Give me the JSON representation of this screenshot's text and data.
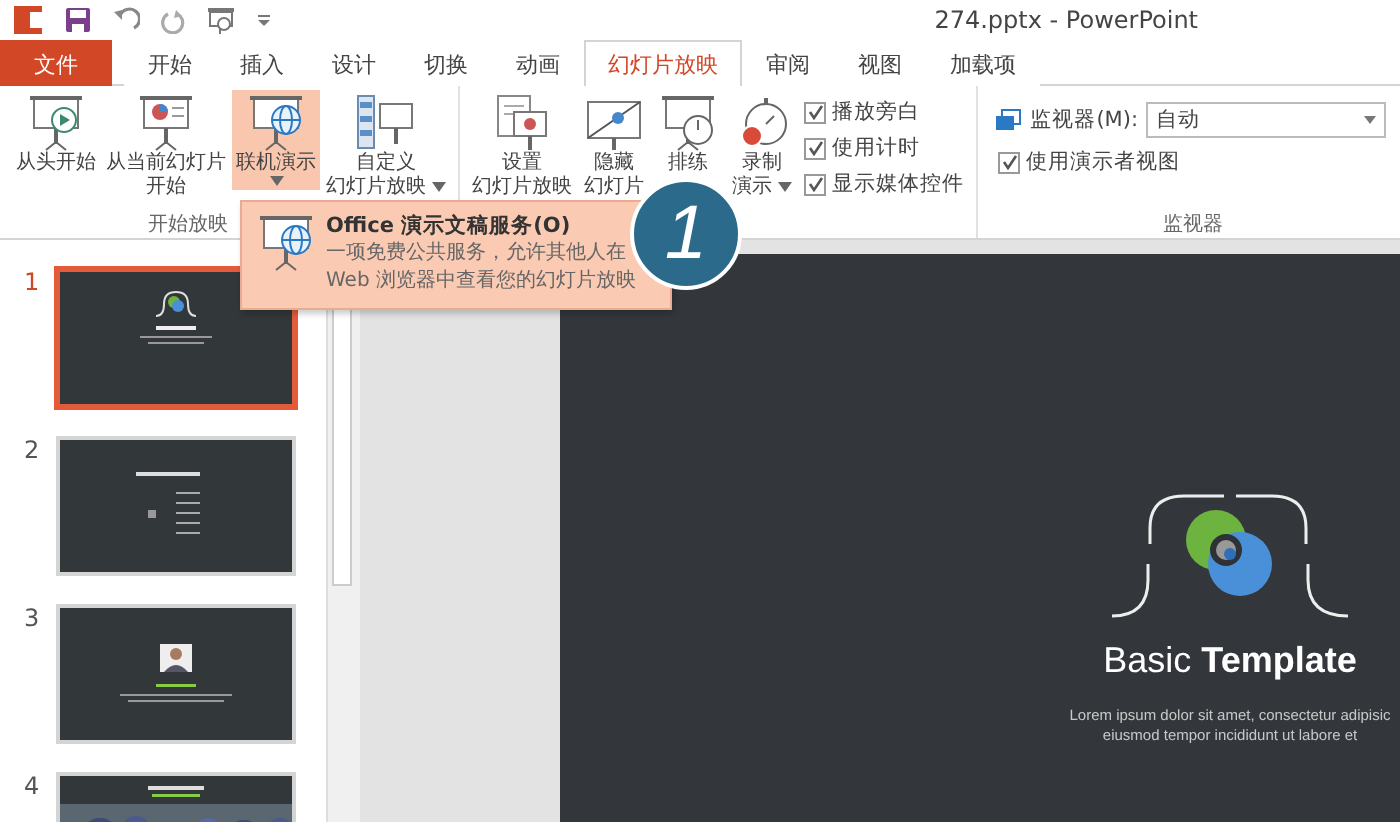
{
  "window": {
    "title": "274.pptx - PowerPoint"
  },
  "tabs": [
    {
      "label": "文件",
      "kind": "file",
      "selected": false
    },
    {
      "label": "开始",
      "kind": "tab",
      "selected": false
    },
    {
      "label": "插入",
      "kind": "tab",
      "selected": false
    },
    {
      "label": "设计",
      "kind": "tab",
      "selected": false
    },
    {
      "label": "切换",
      "kind": "tab",
      "selected": false
    },
    {
      "label": "动画",
      "kind": "tab",
      "selected": false
    },
    {
      "label": "幻灯片放映",
      "kind": "tab",
      "selected": true
    },
    {
      "label": "审阅",
      "kind": "tab",
      "selected": false
    },
    {
      "label": "视图",
      "kind": "tab",
      "selected": false
    },
    {
      "label": "加载项",
      "kind": "tab",
      "selected": false
    }
  ],
  "ribbon": {
    "groups": [
      {
        "label": "开始放映",
        "items": [
          {
            "kind": "button",
            "lines": [
              "从头开始"
            ],
            "menu": false,
            "open": false
          },
          {
            "kind": "button",
            "lines": [
              "从当前幻灯片",
              "开始"
            ],
            "menu": false,
            "open": false
          },
          {
            "kind": "button",
            "lines": [
              "联机演示"
            ],
            "menu": true,
            "open": true
          },
          {
            "kind": "button",
            "lines": [
              "自定义",
              "幻灯片放映"
            ],
            "menu": true,
            "open": false
          }
        ]
      },
      {
        "items": [
          {
            "kind": "button",
            "lines": [
              "设置",
              "幻灯片放映"
            ],
            "menu": false,
            "open": false
          },
          {
            "kind": "button",
            "lines": [
              "隐藏",
              "幻灯片"
            ],
            "menu": false,
            "open": false
          },
          {
            "kind": "button",
            "lines": [
              "排练"
            ],
            "menu": false,
            "open": false
          },
          {
            "kind": "button",
            "lines": [
              "录制",
              "演示"
            ],
            "menu": true,
            "open": false
          },
          {
            "kind": "checks",
            "options": [
              {
                "label": "播放旁白",
                "checked": true
              },
              {
                "label": "使用计时",
                "checked": true
              },
              {
                "label": "显示媒体控件",
                "checked": true
              }
            ]
          }
        ]
      },
      {
        "label": "监视器",
        "items": [
          {
            "kind": "monitor",
            "label": "监视器(M):",
            "value": "自动"
          },
          {
            "kind": "checks",
            "options": [
              {
                "label": "使用演示者视图",
                "checked": true
              }
            ]
          }
        ]
      }
    ]
  },
  "menu": {
    "title": "Office 演示文稿服务(O)",
    "description_lines": [
      "一项免费公共服务，允许其他人在",
      "Web 浏览器中查看您的幻灯片放映"
    ]
  },
  "callout": {
    "label": "1"
  },
  "thumbnails": [
    {
      "number": "1",
      "kind": "title",
      "selected": true
    },
    {
      "number": "2",
      "kind": "agenda",
      "selected": false
    },
    {
      "number": "3",
      "kind": "profile",
      "selected": false
    },
    {
      "number": "4",
      "kind": "photo",
      "selected": false
    }
  ],
  "slide": {
    "title": "Basic **Template**",
    "body_lines": [
      "Lorem ipsum dolor sit amet, consectetur adipisic",
      "eiusmod tempor incididunt ut labore et"
    ]
  }
}
